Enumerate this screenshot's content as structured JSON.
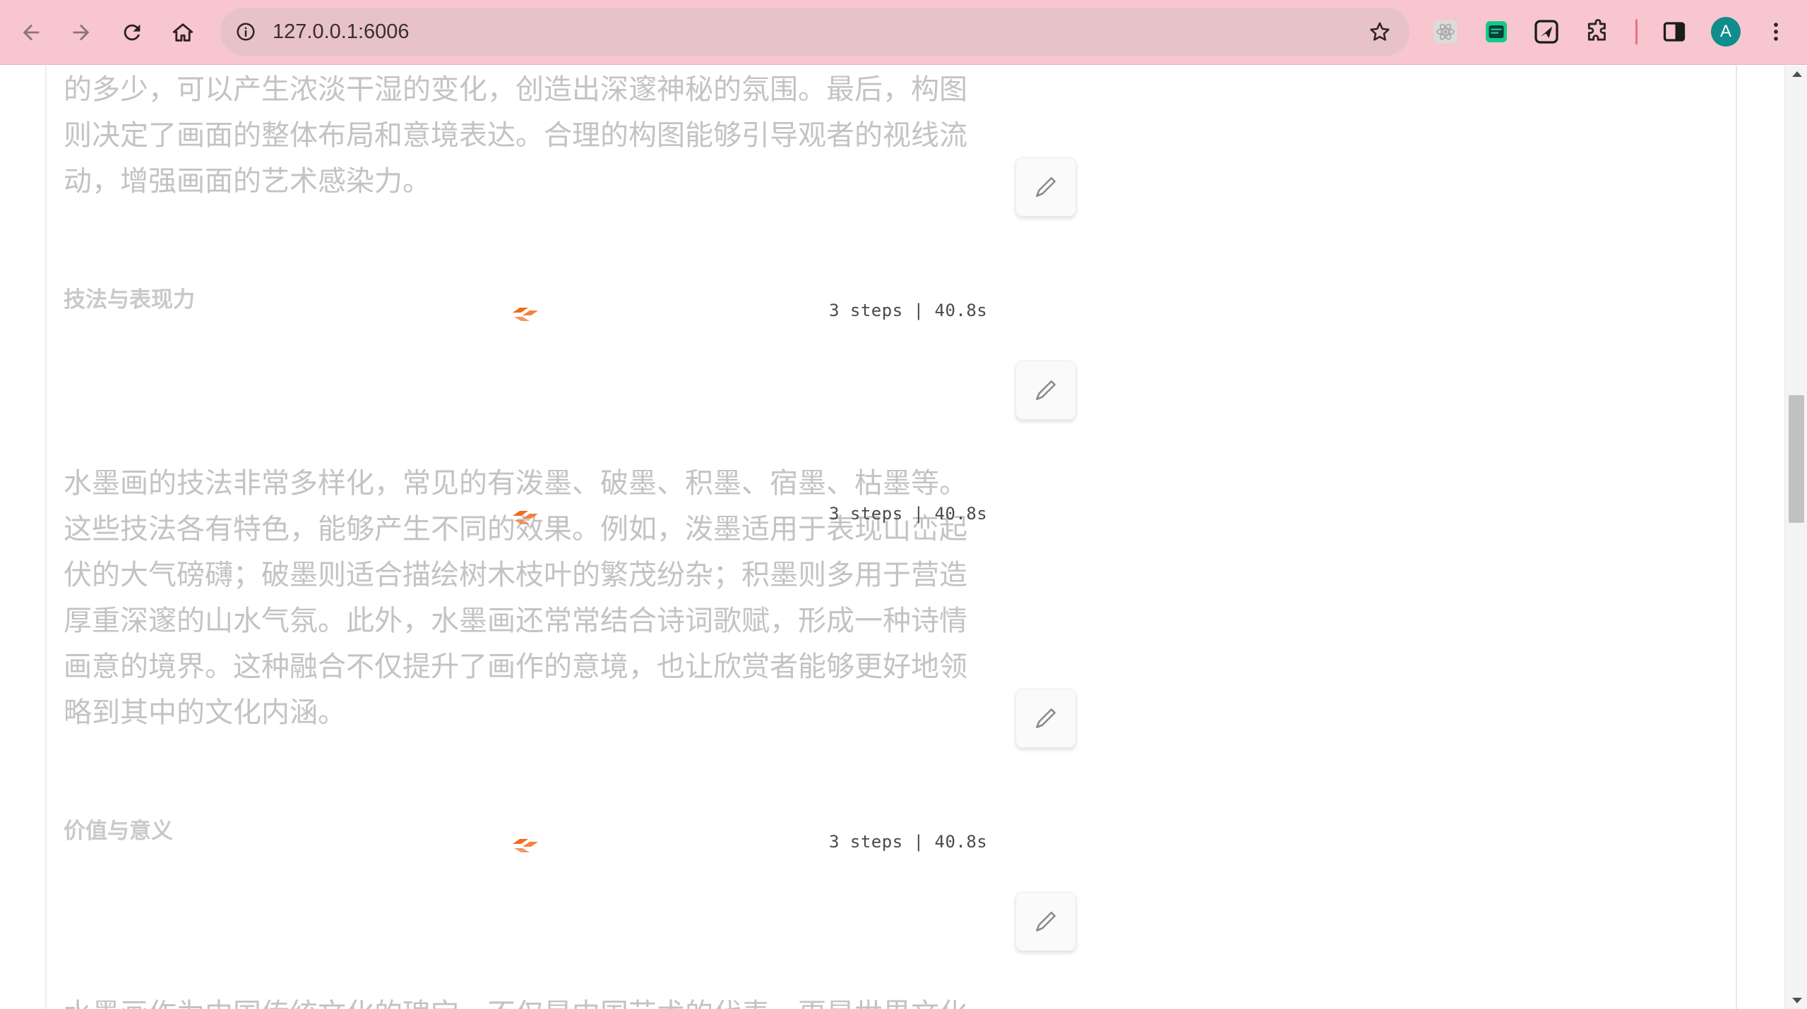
{
  "browser": {
    "url": "127.0.0.1:6006",
    "avatar_letter": "A"
  },
  "content": {
    "para_top": "的多少，可以产生浓淡干湿的变化，创造出深邃神秘的氛围。最后，构图\n则决定了画面的整体布局和意境表达。合理的构图能够引导观者的视线流\n动，增强画面的艺术感染力。",
    "heading_technique": "技法与表现力",
    "para_technique": "水墨画的技法非常多样化，常见的有泼墨、破墨、积墨、宿墨、枯墨等。\n这些技法各有特色，能够产生不同的效果。例如，泼墨适用于表现山峦起\n伏的大气磅礴；破墨则适合描绘树木枝叶的繁茂纷杂；积墨则多用于营造\n厚重深邃的山水气氛。此外，水墨画还常常结合诗词歌赋，形成一种诗情\n画意的境界。这种融合不仅提升了画作的意境，也让欣赏者能够更好地领\n略到其中的文化内涵。",
    "heading_value": "价值与意义",
    "para_bottom_partial": "水墨画作为中国传统文化的瑰宝，不仅是中国艺术的代表，更是世界文化",
    "step_status_1": "3 steps | 40.8s",
    "step_status_2": "3 steps | 40.8s",
    "step_status_3": "3 steps | 40.8s"
  },
  "colors": {
    "chrome": "#f7c6cf",
    "omnibox": "#e7c2c8",
    "loader_accent": "#f26b1d",
    "faded_text": "#c3c3c3"
  },
  "icons": [
    "back-arrow-icon",
    "forward-arrow-icon",
    "reload-icon",
    "home-icon",
    "site-info-icon",
    "bookmark-star-icon",
    "react-devtools-icon",
    "extension-green-icon",
    "send-extension-icon",
    "extensions-puzzle-icon",
    "side-panel-icon",
    "kebab-menu-icon",
    "edit-pen-icon",
    "loader-icon"
  ]
}
